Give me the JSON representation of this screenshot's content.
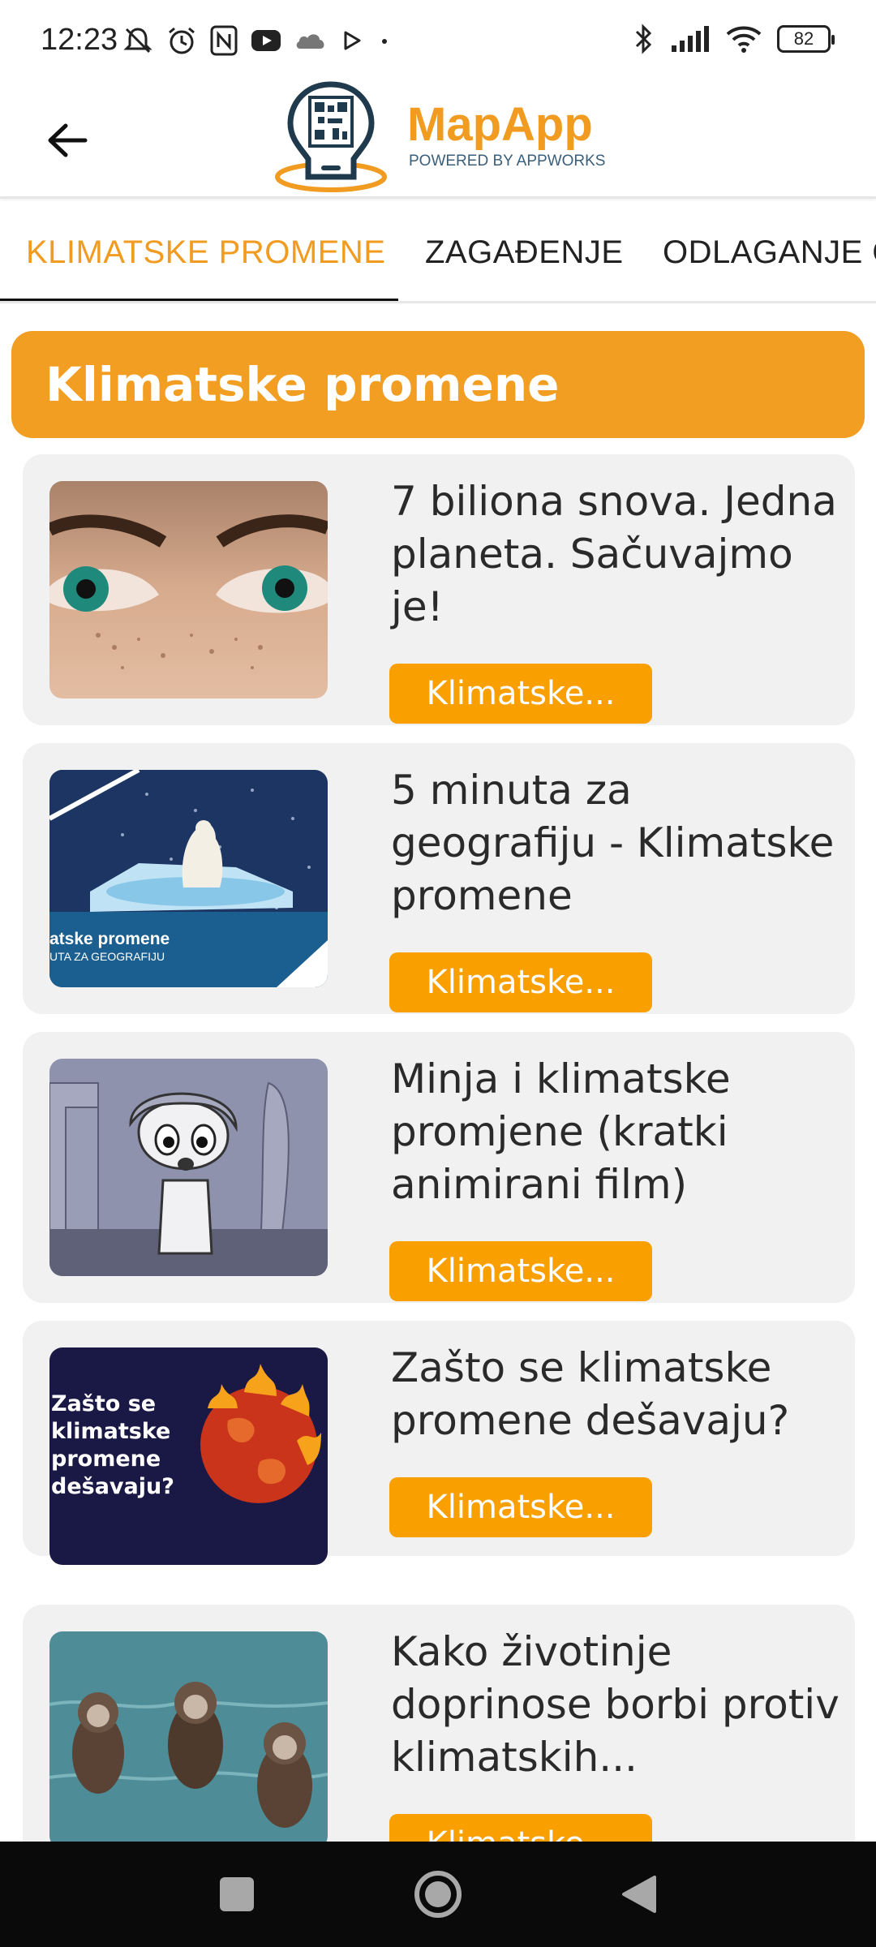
{
  "status_bar": {
    "time": "12:23",
    "battery": "82",
    "icons": [
      "mute-icon",
      "alarm-icon",
      "nfc-icon",
      "youtube-icon",
      "cloud-icon",
      "play-icon",
      "dot-icon",
      "bluetooth-icon",
      "signal-icon",
      "wifi-icon"
    ]
  },
  "app_bar": {
    "logo_title": "MapApp",
    "logo_subtitle": "POWERED BY APPWORKS"
  },
  "tabs": [
    {
      "label": "KLIMATSKE PROMENE",
      "active": true
    },
    {
      "label": "ZAGAĐENJE",
      "active": false
    },
    {
      "label": "ODLAGANJE O",
      "active": false
    }
  ],
  "section": {
    "title": "Klimatske promene"
  },
  "cards": [
    {
      "title": "7 biliona snova. Jedna planeta. Sačuvajmo je!",
      "tag": "Klimatske...",
      "thumb": "eyes-photo"
    },
    {
      "title": "5 minuta za geografiju - Klimatske promene",
      "tag": "Klimatske...",
      "thumb": "polar-bear-photo",
      "thumb_text": [
        "atske promene",
        "UTA ZA GEOGRAFIJU"
      ]
    },
    {
      "title": "Minja i klimatske promjene (kratki animirani film)",
      "tag": "Klimatske...",
      "thumb": "cartoon-girl-illustration"
    },
    {
      "title": "Zašto se klimatske promene dešavaju?",
      "tag": "Klimatske...",
      "thumb": "burning-planet-illustration",
      "thumb_text": [
        "Zašto se",
        "klimatske",
        "promene",
        "dešavaju?"
      ]
    },
    {
      "title": "Kako životinje doprinose borbi protiv klimatskih...",
      "tag": "Klimatske...",
      "thumb": "sea-otters-photo"
    }
  ],
  "colors": {
    "accent": "#F19C21",
    "button": "#F9A000",
    "card_bg": "#f1f1f1",
    "nav_bar": "#0a0a0a"
  }
}
